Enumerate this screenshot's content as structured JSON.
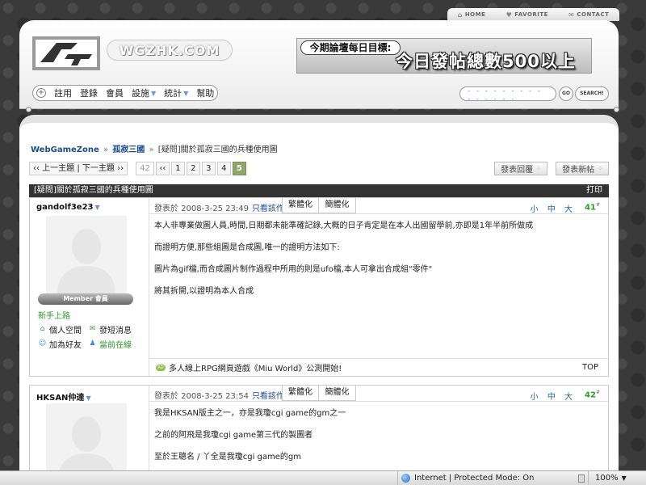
{
  "top_nav": {
    "home": "HOME",
    "favorite": "FAVORITE",
    "contact": "CONTACT"
  },
  "header": {
    "site_name": "WGZHK.COM",
    "banner_line1": "今期論壇每日目標:",
    "banner_line2": "今日發帖總數500以上",
    "menu": [
      {
        "label": "註用",
        "dropdown": false
      },
      {
        "label": "登錄",
        "dropdown": false
      },
      {
        "label": "會員",
        "dropdown": false
      },
      {
        "label": "設施",
        "dropdown": true
      },
      {
        "label": "統計",
        "dropdown": true
      },
      {
        "label": "幫助",
        "dropdown": false
      }
    ],
    "search_value": "- - - - - - - - - - - - - - -",
    "go_label": "GO",
    "search_label": "SEARCH!"
  },
  "breadcrumb": {
    "home": "WebGameZone",
    "sep": "»",
    "forum": "孤寂三國",
    "current": "[疑問]關於孤寂三國的兵種使用圖"
  },
  "pager": {
    "prev_next": "‹‹ 上一主題 | 下一主題 ››",
    "total": "42",
    "first": "‹‹",
    "pages": [
      "1",
      "2",
      "3",
      "4"
    ],
    "current": "5"
  },
  "actions": {
    "reply": "發表回覆",
    "new_post": "發表新帖"
  },
  "thread": {
    "title": "[疑問]關於孤寂三國的兵種使用圖",
    "print": "打印"
  },
  "common": {
    "view_author": "只看該作者",
    "simplified": "繁體化",
    "traditional": "簡體化",
    "font_sizes": "小 中 大",
    "top": "TOP",
    "floor_suffix": "#"
  },
  "posts": [
    {
      "author": "gandolf3e23",
      "rank_badge": "Member 會員",
      "rank_title": "新手上路",
      "actions": {
        "space": "個人空間",
        "message": "發短消息",
        "friend": "加為好友",
        "online": "當前在線"
      },
      "meta": "發表於 2008-3-25 23:49",
      "floor": "41",
      "body": [
        "本人非專業做圖人員,時間,日期都未能準確記錄,大概的日子肯定是在本人出國留學前,亦即是1年半前所做成",
        "而證明方便,那些組圖是合成圖,唯一的證明方法如下:",
        "圖片為gif檔,而合成圖片制作過程中所用的則是ufo檔,本人可拿出合成組\"零件\"",
        "將其拆開,以證明為本人合成"
      ],
      "ad_badge": "RD",
      "ad_text": "多人線上RPG網頁遊戲《Miu World》公測開始!"
    },
    {
      "author": "HKSAN仲達",
      "meta": "發表於 2008-3-25 23:54",
      "floor": "42",
      "body": [
        "我是HKSAN版主之一，亦是我瓊cgi game的gm之一",
        "之前的阿飛是我瓊cgi game第三代的製圖者",
        "至於王聰名 / 丫全是我瓊cgi game的gm"
      ]
    }
  ],
  "status_bar": {
    "zone": "Internet | Protected Mode: On",
    "zoom": "100%"
  }
}
